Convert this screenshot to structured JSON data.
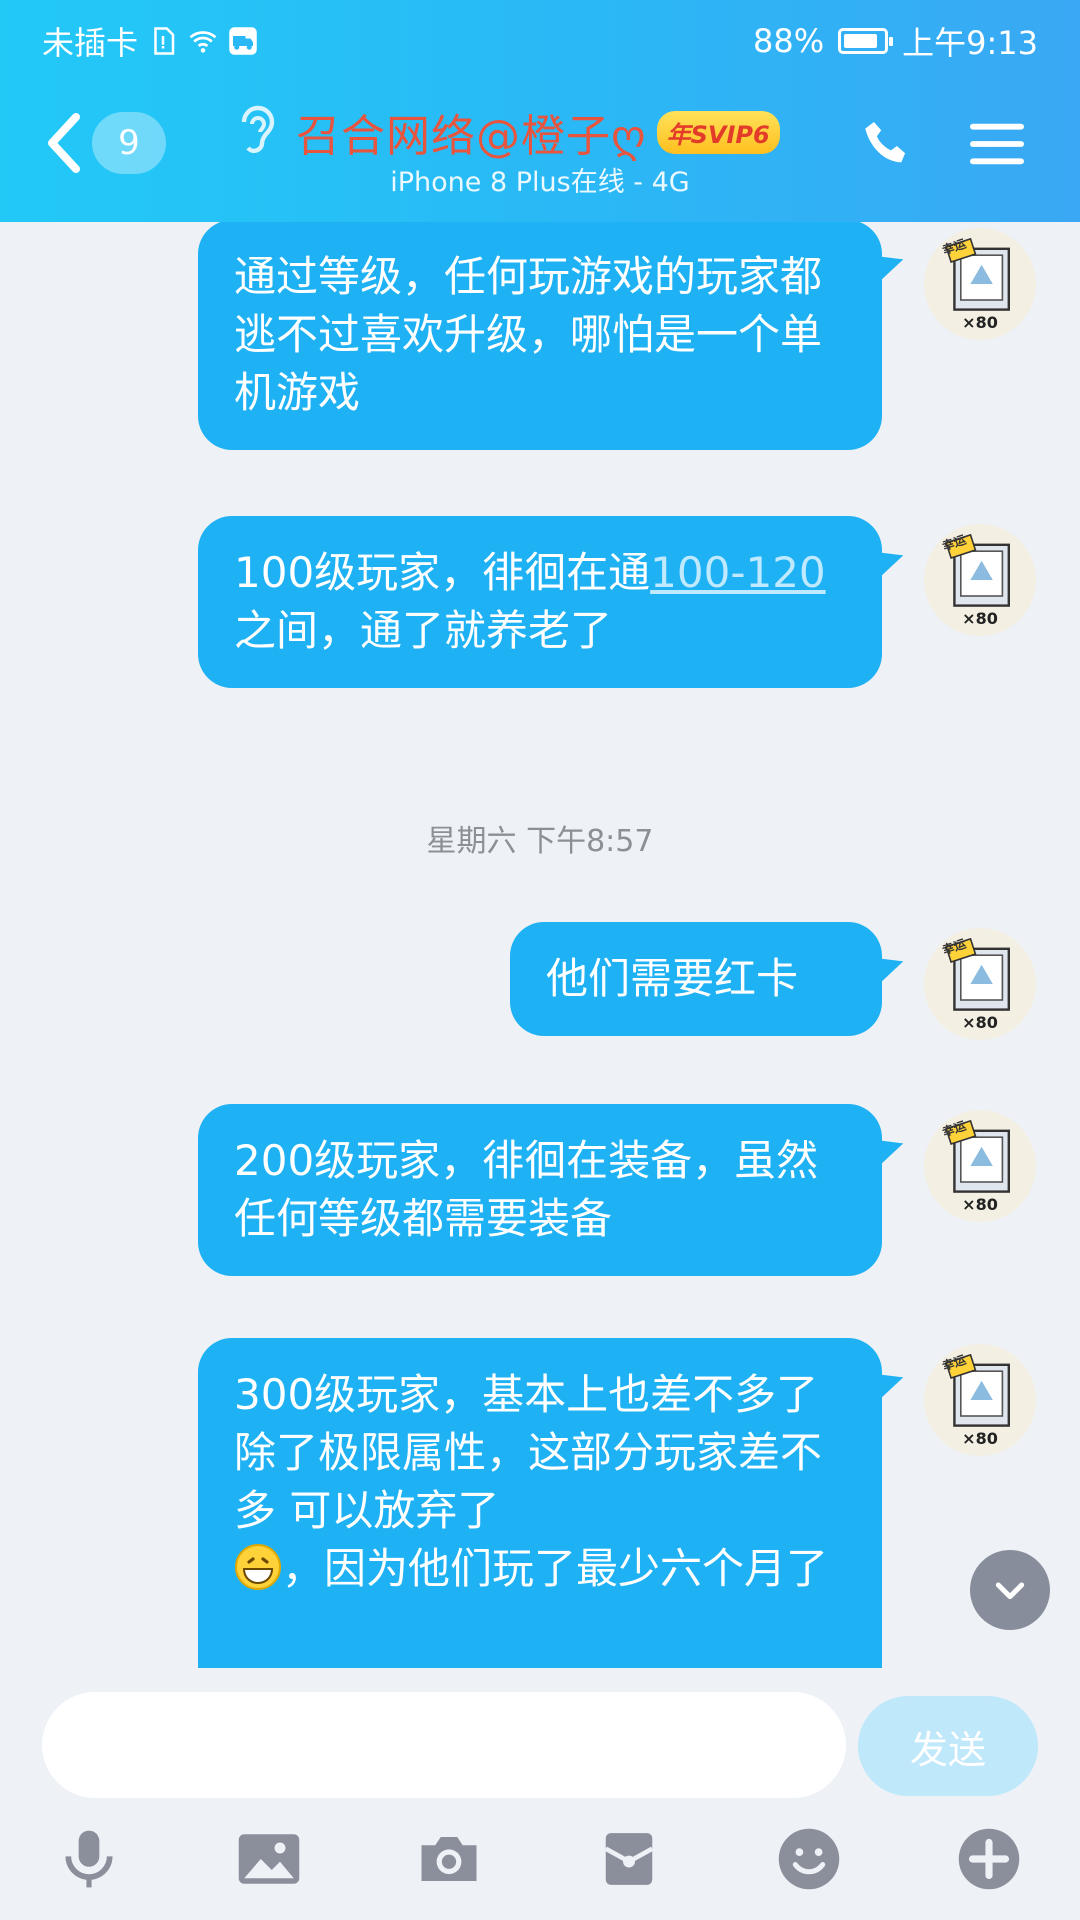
{
  "status_bar": {
    "carrier": "未插卡",
    "battery": "88%",
    "battery_level": 0.88,
    "time": "上午9:13"
  },
  "nav": {
    "unread_count": "9",
    "title": "召合网络@橙子ღ",
    "vip_badge": "年SVIP6",
    "subtitle": "iPhone 8 Plus在线 - 4G"
  },
  "messages": [
    {
      "segments": [
        "通过等级，任何玩游戏的玩家都逃不过喜欢升级，哪怕是一个单机游戏"
      ]
    },
    {
      "segments": [
        "100级玩家，徘徊在通",
        "100-120",
        "之间，通了就养老了"
      ]
    },
    {
      "timestamp": "星期六 下午8:57"
    },
    {
      "segments": [
        "他们需要红卡"
      ]
    },
    {
      "segments": [
        "200级玩家，徘徊在装备，虽然任何等级都需要装备"
      ]
    },
    {
      "segments": [
        "300级玩家，基本上也差不多了 除了极限属性，这部分玩家差不多 可以放弃了",
        "，因为他们玩了最少六个月了"
      ]
    }
  ],
  "avatar_badge": "×80",
  "avatar_tag": "幸运",
  "input": {
    "placeholder": "",
    "send_label": "发送"
  },
  "toolbar": [
    "mic-icon",
    "image-icon",
    "camera-icon",
    "red-packet-icon",
    "emoji-icon",
    "plus-icon"
  ],
  "colors": {
    "header": "#2ab8f6",
    "bubble": "#1eb1f3",
    "title": "#e8553f",
    "send_disabled": "#bfe8fb"
  }
}
